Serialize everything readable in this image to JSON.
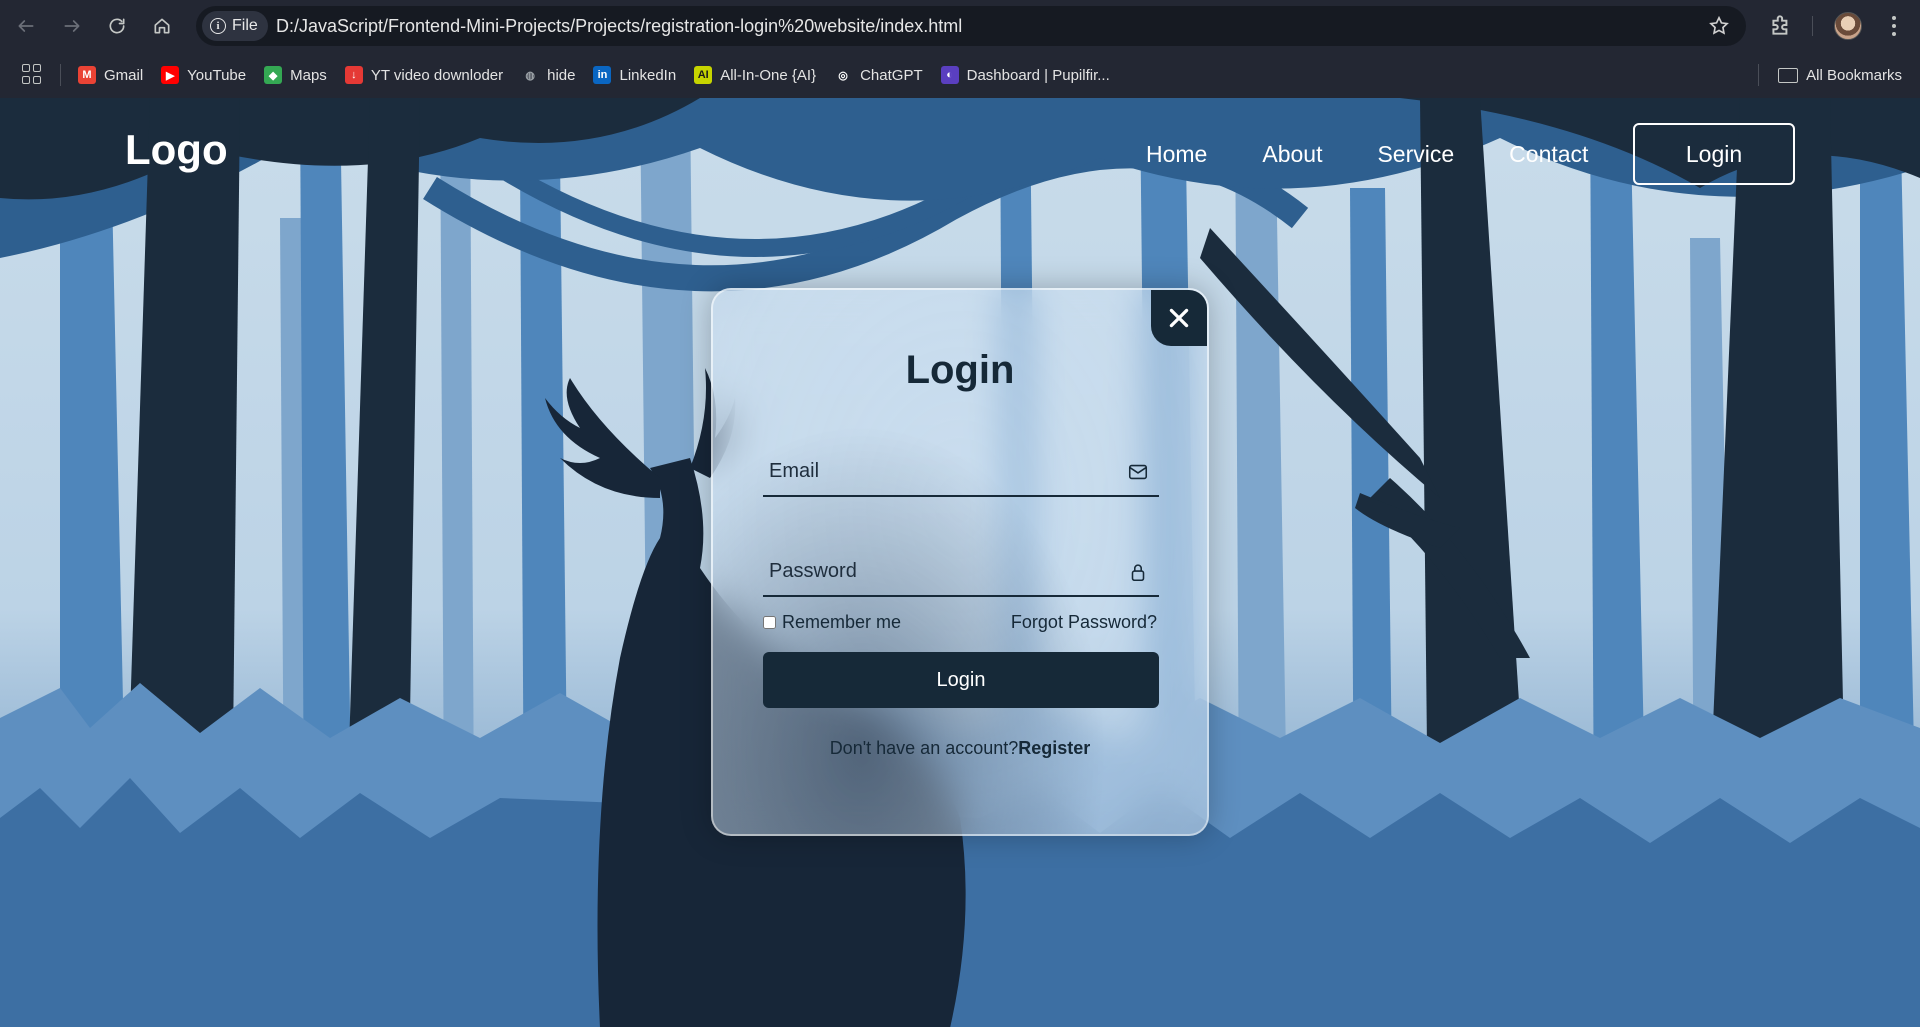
{
  "browser": {
    "file_chip": "File",
    "url": "D:/JavaScript/Frontend-Mini-Projects/Projects/registration-login%20website/index.html",
    "bookmarks": [
      {
        "label": "Gmail",
        "icon": "gmail-icon",
        "color": "#ea4335"
      },
      {
        "label": "YouTube",
        "icon": "youtube-icon",
        "color": "#ff0000"
      },
      {
        "label": "Maps",
        "icon": "maps-icon",
        "color": "#34a853"
      },
      {
        "label": "YT video downloder",
        "icon": "download-icon",
        "color": "#e53935"
      },
      {
        "label": "hide",
        "icon": "globe-icon",
        "color": "#9aa0a6"
      },
      {
        "label": "LinkedIn",
        "icon": "linkedin-icon",
        "color": "#0a66c2"
      },
      {
        "label": "All-In-One {AI}",
        "icon": "ai-icon",
        "color": "#c6d400"
      },
      {
        "label": "ChatGPT",
        "icon": "chatgpt-icon",
        "color": "#ffffff"
      },
      {
        "label": "Dashboard | Pupilfir...",
        "icon": "dashboard-icon",
        "color": "#5a3fc0"
      }
    ],
    "all_bookmarks": "All Bookmarks"
  },
  "site": {
    "logo": "Logo",
    "nav": [
      "Home",
      "About",
      "Service",
      "Contact"
    ],
    "login_button": "Login"
  },
  "login_form": {
    "title": "Login",
    "email_placeholder": "Email",
    "password_placeholder": "Password",
    "remember_label": "Remember me",
    "forgot_label": "Forgot Password?",
    "submit_label": "Login",
    "register_prompt": "Don't have an account?",
    "register_link": "Register"
  },
  "colors": {
    "primary": "#162938",
    "sky": "#c9dcea",
    "tree_dark": "#1b2c3d",
    "tree_mid": "#2e5f8f",
    "tree_light": "#4f86bb"
  }
}
